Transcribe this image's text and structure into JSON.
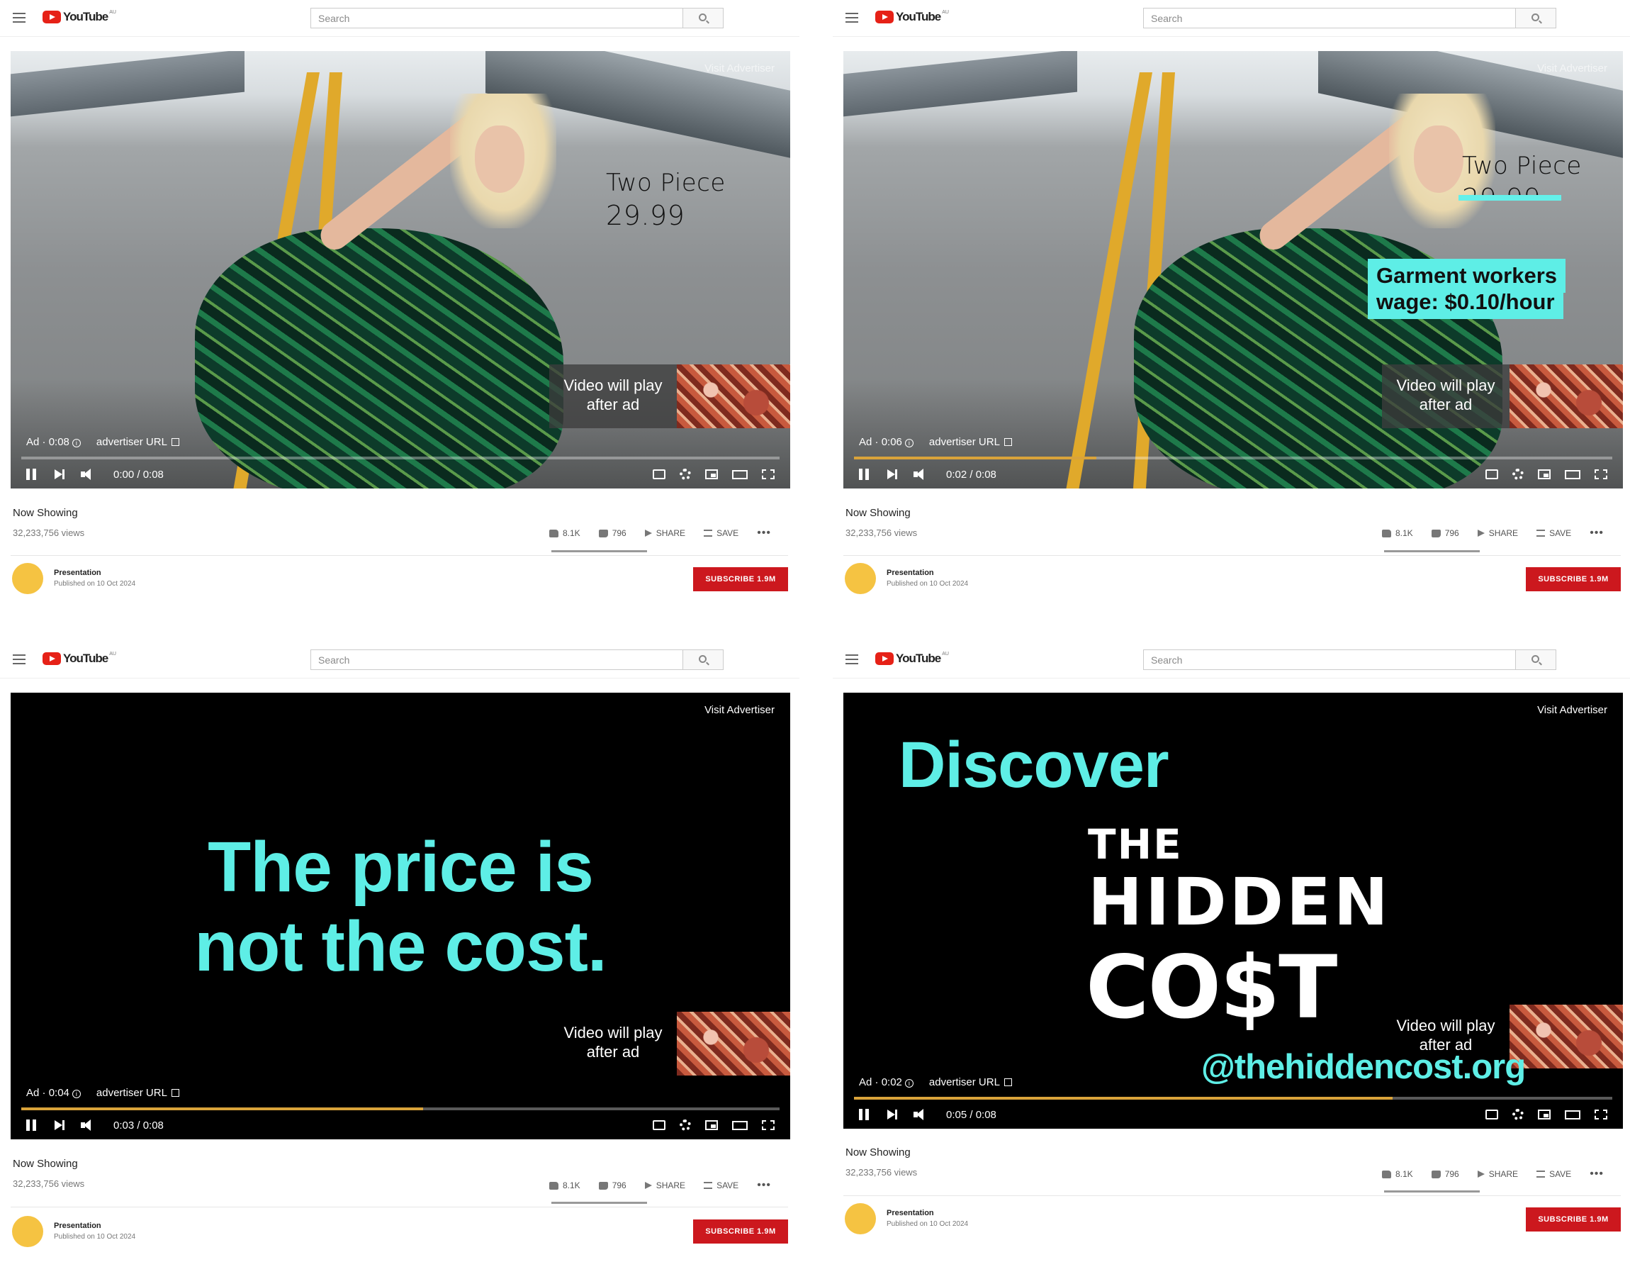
{
  "app": {
    "logo_text": "YouTube",
    "region": "AU",
    "search_placeholder": "Search"
  },
  "video": {
    "visit_advertiser": "Visit Advertiser",
    "ad_prefix": "Ad",
    "advertiser_url": "advertiser URL",
    "promo_text_line1": "Video will play",
    "promo_text_line2": "after ad"
  },
  "meta": {
    "title": "Now Showing",
    "views": "32,233,756 views",
    "likes": "8.1K",
    "dislikes": "796",
    "share": "SHARE",
    "save": "SAVE",
    "more": "•••",
    "channel": "Presentation",
    "published": "Published on 10 Oct 2024",
    "subscribe": "SUBSCRIBE 1.9M"
  },
  "panels": [
    {
      "ad_remaining": "0:08",
      "time": "0:00 / 0:08",
      "progress": 0.0,
      "overlay": {
        "line1": "Two Piece",
        "line2": "29.99"
      }
    },
    {
      "ad_remaining": "0:06",
      "time": "0:02 / 0:08",
      "progress": 0.32,
      "overlay": {
        "line1": "Two Piece",
        "line2": "29.99",
        "callout1": "Garment workers",
        "callout2": "wage: $0.10/hour"
      }
    },
    {
      "ad_remaining": "0:04",
      "time": "0:03 / 0:08",
      "progress": 0.53,
      "overlay": {
        "line1": "The price is",
        "line2": "not the cost."
      }
    },
    {
      "ad_remaining": "0:02",
      "time": "0:05 / 0:08",
      "progress": 0.71,
      "overlay": {
        "discover": "Discover",
        "the": "THE",
        "hidden": "HIDDEN",
        "cost": "CO$T",
        "handle": "@thehiddencost.org"
      }
    }
  ],
  "colors": {
    "accent": "#5eeee6",
    "youtube_red": "#cc181e",
    "progress": "#d9a33a",
    "avatar": "#f5c342"
  }
}
